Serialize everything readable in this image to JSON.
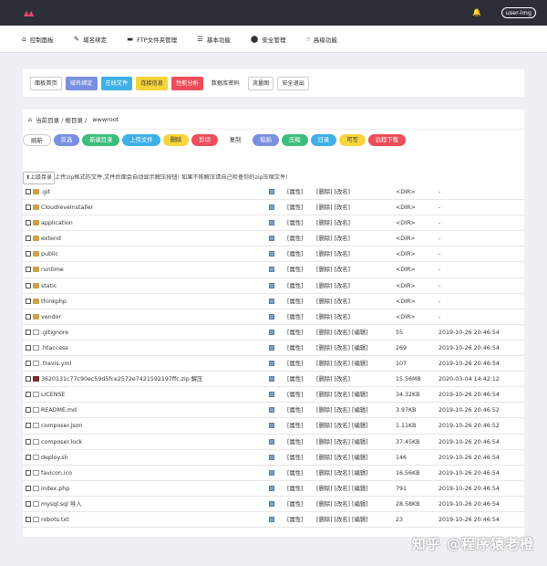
{
  "topbar": {
    "user": "user-img"
  },
  "nav": [
    {
      "label": "控制面板",
      "icon": "home-icon"
    },
    {
      "label": "域名绑定",
      "icon": "link-icon"
    },
    {
      "label": "FTP文件夹管理",
      "icon": "folder-icon"
    },
    {
      "label": "基本功能",
      "icon": "list-icon"
    },
    {
      "label": "安全管理",
      "icon": "shield-icon"
    },
    {
      "label": "高级功能",
      "icon": "hand-icon"
    }
  ],
  "tabs": [
    {
      "label": "面板首页",
      "style": "outline"
    },
    {
      "label": "域名绑定",
      "style": "filled",
      "color": "#7b8ee0"
    },
    {
      "label": "在线文件",
      "style": "filled",
      "color": "#3fb0e6"
    },
    {
      "label": "连接信息",
      "style": "filled",
      "color": "#f5d53b"
    },
    {
      "label": "性能分析",
      "style": "filled",
      "color": "#ee4d5b"
    },
    {
      "label": "数据库密码",
      "style": "plain"
    },
    {
      "label": "流量图",
      "style": "outline"
    },
    {
      "label": "安全退出",
      "style": "outline"
    }
  ],
  "breadcrumb": {
    "text": "当前目录 / 根目录 /",
    "current": "wwwroot"
  },
  "actions": [
    {
      "label": "刷新",
      "color": "#ffffff",
      "text": "#333333",
      "border": "#cccccc"
    },
    {
      "label": "反选",
      "color": "#7b8ee0"
    },
    {
      "label": "新建目录",
      "color": "#3dbd7d"
    },
    {
      "label": "上传文件",
      "color": "#3fb0e6"
    },
    {
      "label": "删除",
      "color": "#f5d53b",
      "text": "#333333"
    },
    {
      "label": "剪切",
      "color": "#ee4d5b"
    },
    {
      "label": "复制",
      "color": "plain"
    },
    {
      "label": "粘贴",
      "color": "#7b8ee0"
    },
    {
      "label": "压缩",
      "color": "#3dbd7d"
    },
    {
      "label": "日录",
      "color": "#3fb0e6"
    },
    {
      "label": "可写",
      "color": "#f5d53b",
      "text": "#333333"
    },
    {
      "label": "远程下载",
      "color": "#ee4d5b"
    }
  ],
  "upload": {
    "button": "⬆上级目录",
    "hint": "上传zip格式的文件,文件后面会自动显示解压按钮! 如果不能解压请自己检查你的zip压缩文件!"
  },
  "files": [
    {
      "name": ".git",
      "type": "folder",
      "attr": "[属性]",
      "ops": "[删除] [改名]",
      "size": "<DIR>",
      "mtime": "-"
    },
    {
      "name": "CloudreveInstaller",
      "type": "folder",
      "attr": "[属性]",
      "ops": "[删除] [改名]",
      "size": "<DIR>",
      "mtime": "-"
    },
    {
      "name": "application",
      "type": "folder",
      "attr": "[属性]",
      "ops": "[删除] [改名]",
      "size": "<DIR>",
      "mtime": "-"
    },
    {
      "name": "extend",
      "type": "folder",
      "attr": "[属性]",
      "ops": "[删除] [改名]",
      "size": "<DIR>",
      "mtime": "-"
    },
    {
      "name": "public",
      "type": "folder",
      "attr": "[属性]",
      "ops": "[删除] [改名]",
      "size": "<DIR>",
      "mtime": "-"
    },
    {
      "name": "runtime",
      "type": "folder",
      "attr": "[属性]",
      "ops": "[删除] [改名]",
      "size": "<DIR>",
      "mtime": "-"
    },
    {
      "name": "static",
      "type": "folder",
      "attr": "[属性]",
      "ops": "[删除] [改名]",
      "size": "<DIR>",
      "mtime": "-"
    },
    {
      "name": "thinkphp",
      "type": "folder",
      "attr": "[属性]",
      "ops": "[删除] [改名]",
      "size": "<DIR>",
      "mtime": "-"
    },
    {
      "name": "vendor",
      "type": "folder",
      "attr": "[属性]",
      "ops": "[删除] [改名]",
      "size": "<DIR>",
      "mtime": "-"
    },
    {
      "name": ".gitignore",
      "type": "file",
      "attr": "[属性]",
      "ops": "[删除] [改名] [编辑]",
      "size": "55",
      "mtime": "2019-10-26 20:46:54"
    },
    {
      "name": ".htaccess",
      "type": "file",
      "attr": "[属性]",
      "ops": "[删除] [改名] [编辑]",
      "size": "269",
      "mtime": "2019-10-26 20:46:54"
    },
    {
      "name": ".travis.yml",
      "type": "file",
      "attr": "[属性]",
      "ops": "[删除] [改名] [编辑]",
      "size": "107",
      "mtime": "2019-10-26 20:46:54"
    },
    {
      "name": "3620131c77c90ec59d5fce2572e7421592197ffc.zip 解压",
      "type": "zip",
      "attr": "[属性]",
      "ops": "[删除] [改名]",
      "size": "15.56MB",
      "mtime": "2020-03-04 14:42:12"
    },
    {
      "name": "LICENSE",
      "type": "file",
      "attr": "[属性]",
      "ops": "[删除] [改名] [编辑]",
      "size": "34.32KB",
      "mtime": "2019-10-26 20:46:54"
    },
    {
      "name": "README.md",
      "type": "file",
      "attr": "[属性]",
      "ops": "[删除] [改名] [编辑]",
      "size": "3.97KB",
      "mtime": "2019-10-26 20:46:52"
    },
    {
      "name": "composer.json",
      "type": "file",
      "attr": "[属性]",
      "ops": "[删除] [改名] [编辑]",
      "size": "1.11KB",
      "mtime": "2019-10-26 20:46:52"
    },
    {
      "name": "composer.lock",
      "type": "file",
      "attr": "[属性]",
      "ops": "[删除] [改名] [编辑]",
      "size": "37.45KB",
      "mtime": "2019-10-26 20:46:54"
    },
    {
      "name": "deploy.sh",
      "type": "file",
      "attr": "[属性]",
      "ops": "[删除] [改名] [编辑]",
      "size": "146",
      "mtime": "2019-10-26 20:46:54"
    },
    {
      "name": "favicon.ico",
      "type": "file",
      "attr": "[属性]",
      "ops": "[删除] [改名] [编辑]",
      "size": "16.56KB",
      "mtime": "2019-10-26 20:46:54"
    },
    {
      "name": "index.php",
      "type": "file",
      "attr": "[属性]",
      "ops": "[删除] [改名] [编辑]",
      "size": "791",
      "mtime": "2019-10-26 20:46:54"
    },
    {
      "name": "mysql.sql 导入",
      "type": "file",
      "attr": "[属性]",
      "ops": "[删除] [改名] [编辑]",
      "size": "28.58KB",
      "mtime": "2019-10-26 20:46:54"
    },
    {
      "name": "robots.txt",
      "type": "file",
      "attr": "[属性]",
      "ops": "[删除] [改名] [编辑]",
      "size": "23",
      "mtime": "2019-10-26 20:46:54"
    }
  ],
  "watermark": "知乎 @程序猿老橙"
}
